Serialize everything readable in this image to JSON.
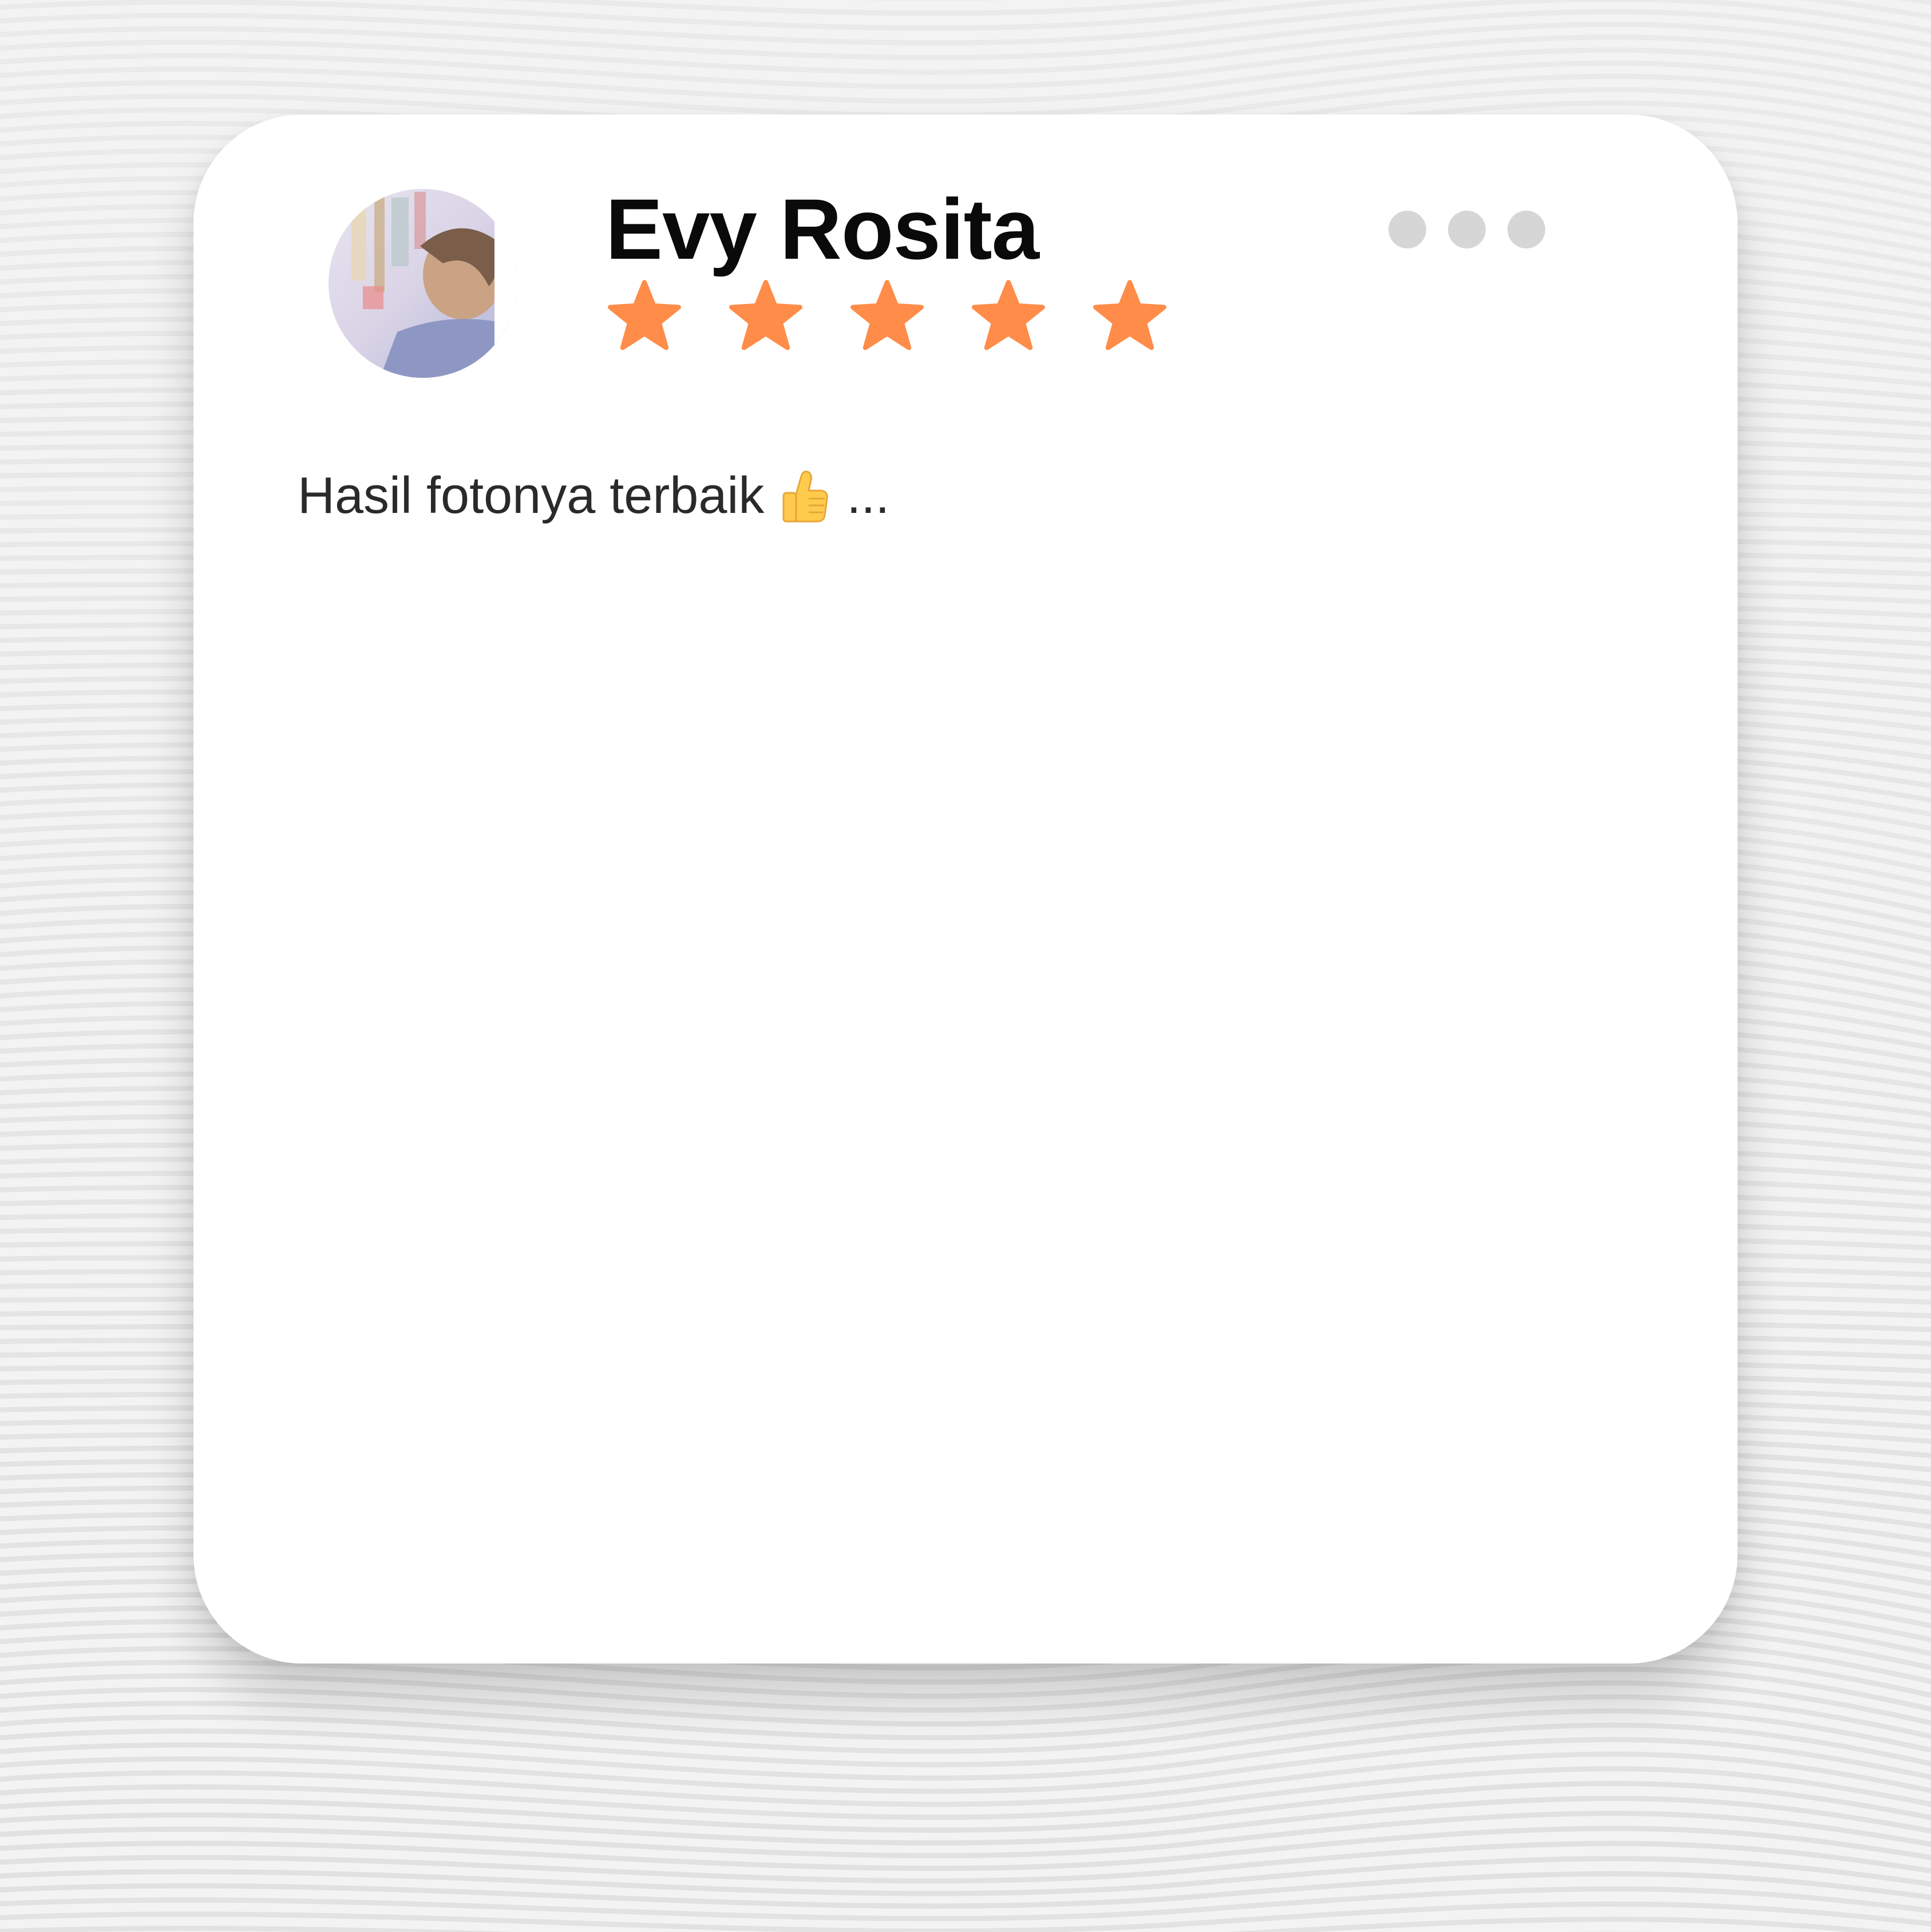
{
  "review_card": {
    "reviewer_name": "Evy Rosita",
    "rating": 5,
    "rating_max": 5,
    "review_text": "Hasil fotonya terbaik",
    "emoji_icon": "thumbs-up-icon",
    "ellipsis": "...",
    "menu_icon": "more-options-icon"
  },
  "colors": {
    "star": "#FF8C48",
    "menu_dots": "#D6D6D6",
    "card_background": "#FFFFFF",
    "page_background": "#F2F2F2",
    "name_text": "#0A0A0A",
    "body_text": "#2A2A2A"
  }
}
